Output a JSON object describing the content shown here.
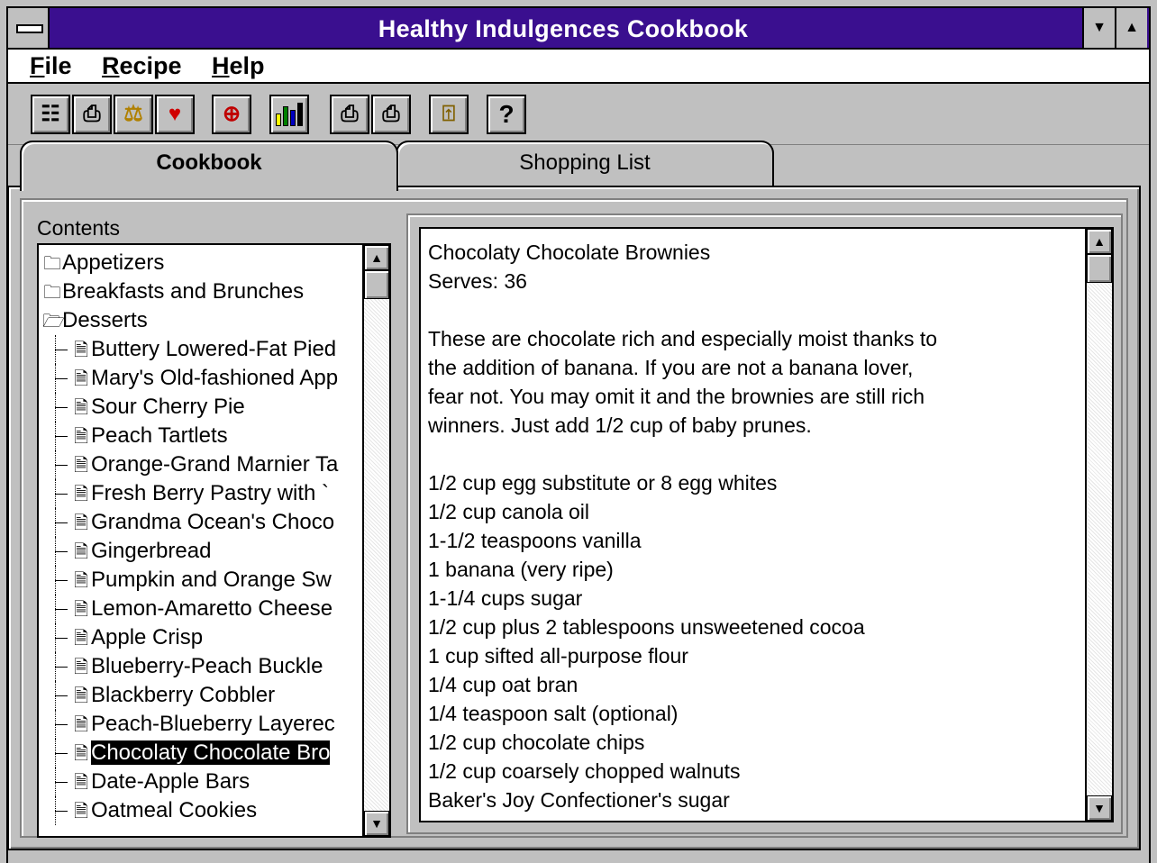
{
  "window": {
    "title": "Healthy Indulgences Cookbook"
  },
  "menu": [
    "File",
    "Recipe",
    "Help"
  ],
  "toolbar": [
    {
      "icon": "list-icon",
      "glyph": "☷"
    },
    {
      "icon": "camera-icon",
      "glyph": "⎙"
    },
    {
      "icon": "scales-icon",
      "glyph": "⚖"
    },
    {
      "icon": "heart-icon",
      "glyph": "♥"
    },
    {
      "icon": "magnify-icon",
      "glyph": "⊕"
    },
    {
      "icon": "bar-chart-icon",
      "glyph": "▮"
    },
    {
      "icon": "print-icon",
      "glyph": "⎙"
    },
    {
      "icon": "print-setup-icon",
      "glyph": "⎙"
    },
    {
      "icon": "exit-door-icon",
      "glyph": "⍐"
    },
    {
      "icon": "help-icon",
      "glyph": "?"
    }
  ],
  "tabs": {
    "cookbook": "Cookbook",
    "shopping": "Shopping List"
  },
  "contents": {
    "label": "Contents",
    "items": [
      {
        "type": "folder",
        "label": "Appetizers"
      },
      {
        "type": "folder",
        "label": "Breakfasts and Brunches"
      },
      {
        "type": "folder-open",
        "label": "Desserts"
      },
      {
        "type": "recipe",
        "label": "Buttery Lowered-Fat Pied"
      },
      {
        "type": "recipe",
        "label": "Mary's Old-fashioned App"
      },
      {
        "type": "recipe",
        "label": "Sour Cherry Pie"
      },
      {
        "type": "recipe",
        "label": "Peach Tartlets"
      },
      {
        "type": "recipe",
        "label": "Orange-Grand Marnier Ta"
      },
      {
        "type": "recipe",
        "label": "Fresh Berry Pastry with `"
      },
      {
        "type": "recipe",
        "label": "Grandma Ocean's Choco"
      },
      {
        "type": "recipe",
        "label": "Gingerbread"
      },
      {
        "type": "recipe",
        "label": "Pumpkin and Orange Sw"
      },
      {
        "type": "recipe",
        "label": "Lemon-Amaretto Cheese"
      },
      {
        "type": "recipe",
        "label": "Apple Crisp"
      },
      {
        "type": "recipe",
        "label": "Blueberry-Peach Buckle"
      },
      {
        "type": "recipe",
        "label": "Blackberry Cobbler"
      },
      {
        "type": "recipe",
        "label": "Peach-Blueberry Layerec"
      },
      {
        "type": "recipe",
        "label": "Chocolaty Chocolate Bro",
        "selected": true
      },
      {
        "type": "recipe",
        "label": "Date-Apple Bars"
      },
      {
        "type": "recipe",
        "label": "Oatmeal Cookies"
      }
    ]
  },
  "recipe": {
    "lines": [
      "Chocolaty Chocolate Brownies",
      "Serves: 36",
      "",
      "These are chocolate rich and especially moist thanks to",
      "the addition of banana. If you are not a banana lover,",
      "fear not. You may omit it and the brownies are still rich",
      "winners. Just add 1/2 cup of baby prunes.",
      "",
      "1/2 cup egg substitute or 8 egg whites",
      "1/2 cup canola oil",
      "1-1/2 teaspoons vanilla",
      "1 banana (very ripe)",
      "1-1/4 cups sugar",
      "1/2 cup plus 2 tablespoons unsweetened cocoa",
      "1 cup sifted all-purpose flour",
      "1/4 cup oat bran",
      "1/4 teaspoon salt (optional)",
      "1/2 cup chocolate chips",
      "1/2 cup coarsely chopped walnuts",
      "Baker's Joy Confectioner's sugar"
    ]
  }
}
